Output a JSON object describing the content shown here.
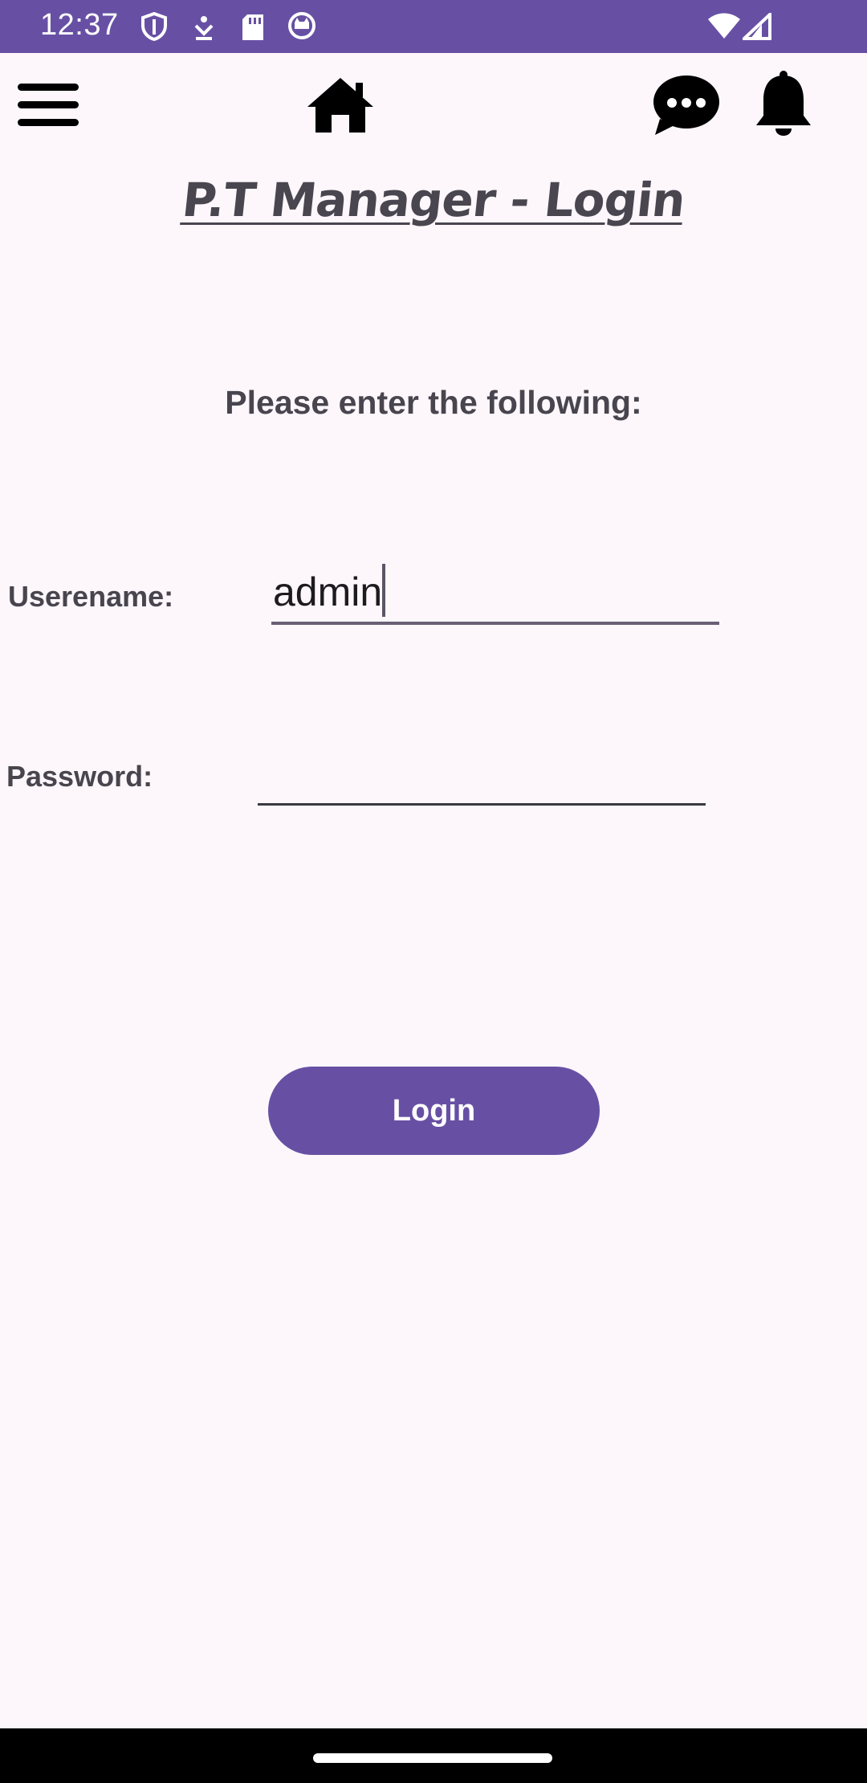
{
  "status_bar": {
    "time": "12:37",
    "background": "#6750a4",
    "icons": [
      "shield-icon",
      "download-icon",
      "sd-card-icon",
      "cat-face-icon",
      "wifi-icon",
      "cell-signal-icon"
    ]
  },
  "toolbar": {
    "icons": [
      "menu-icon",
      "home-icon",
      "chat-icon",
      "bell-icon"
    ]
  },
  "page": {
    "title": "P.T Manager - Login",
    "instruction": "Please enter the following:"
  },
  "form": {
    "username_label": "Userename:",
    "username_value": "admin",
    "password_label": "Password:",
    "password_value": "",
    "login_label": "Login"
  },
  "colors": {
    "accent": "#6750a4",
    "background": "#fdf7fc",
    "text": "#48454e"
  }
}
